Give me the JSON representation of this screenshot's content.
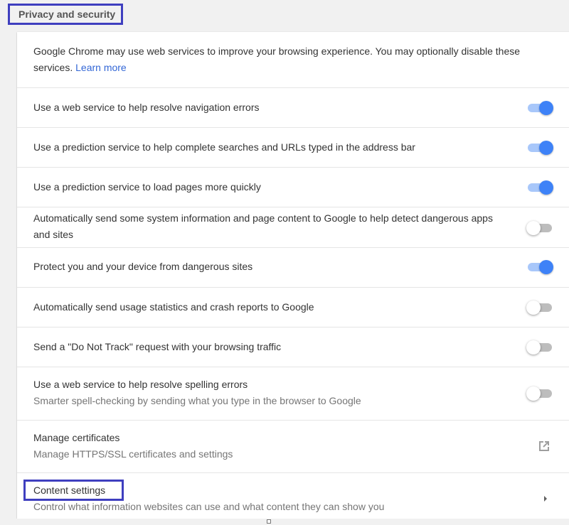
{
  "section": {
    "title": "Privacy and security"
  },
  "intro": {
    "text": "Google Chrome may use web services to improve your browsing experience. You may optionally disable these services.",
    "link": "Learn more"
  },
  "settings": [
    {
      "label": "Use a web service to help resolve navigation errors",
      "enabled": true
    },
    {
      "label": "Use a prediction service to help complete searches and URLs typed in the address bar",
      "enabled": true
    },
    {
      "label": "Use a prediction service to load pages more quickly",
      "enabled": true
    },
    {
      "label": "Automatically send some system information and page content to Google to help detect dangerous apps and sites",
      "enabled": false
    },
    {
      "label": "Protect you and your device from dangerous sites",
      "enabled": true
    },
    {
      "label": "Automatically send usage statistics and crash reports to Google",
      "enabled": false
    },
    {
      "label": "Send a \"Do Not Track\" request with your browsing traffic",
      "enabled": false
    },
    {
      "label": "Use a web service to help resolve spelling errors",
      "secondary": "Smarter spell-checking by sending what you type in the browser to Google",
      "enabled": false
    }
  ],
  "certificates": {
    "label": "Manage certificates",
    "secondary": "Manage HTTPS/SSL certificates and settings",
    "icon": "open-in-new-icon"
  },
  "content_settings": {
    "label": "Content settings",
    "secondary": "Control what information websites can use and what content they can show you",
    "icon": "chevron-right-icon"
  },
  "colors": {
    "accent": "#3e82f7",
    "highlight": "#3f3fbf",
    "link": "#3367d6"
  }
}
